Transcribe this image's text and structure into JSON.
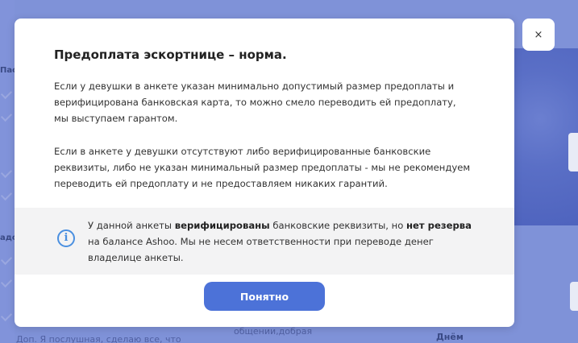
{
  "background": {
    "left_fragment_1": "Пас",
    "left_fragment_2": "адо",
    "bottom_text_1": "общении,добрая",
    "bottom_text_2": "Доп. Я послушная, сделаю все, что",
    "bottom_right_label": "Днём"
  },
  "modal": {
    "title": "Предоплата эскортнице – норма.",
    "paragraph_1": "Если у девушки в анкете указан минимально допустимый размер предоплаты и верифицирована банковская карта, то можно смело переводить ей предоплату, мы выступаем гарантом.",
    "paragraph_2": "Если в анкете у девушки отсутствуют либо верифицированные банковские реквизиты, либо не указан минимальный размер предоплаты - мы не рекомендуем переводить ей предоплату и не предоставляем никаких гарантий.",
    "notice": {
      "icon": "info-icon",
      "icon_glyph": "i",
      "text_part_1": "У данной анкеты ",
      "text_bold_1": "верифицированы",
      "text_part_2": " банковские реквизиты, но ",
      "text_bold_2": "нет резерва",
      "text_part_3": " на балансе Ashoo. Мы не несем ответственности при переводе денег владелице анкеты."
    },
    "ok_button_label": "Понятно"
  },
  "close_button_glyph": "×",
  "colors": {
    "accent": "#4c72d8",
    "info": "#4a8fe0",
    "notice_bg": "#f3f3f4",
    "backdrop": "#7f92d8"
  }
}
